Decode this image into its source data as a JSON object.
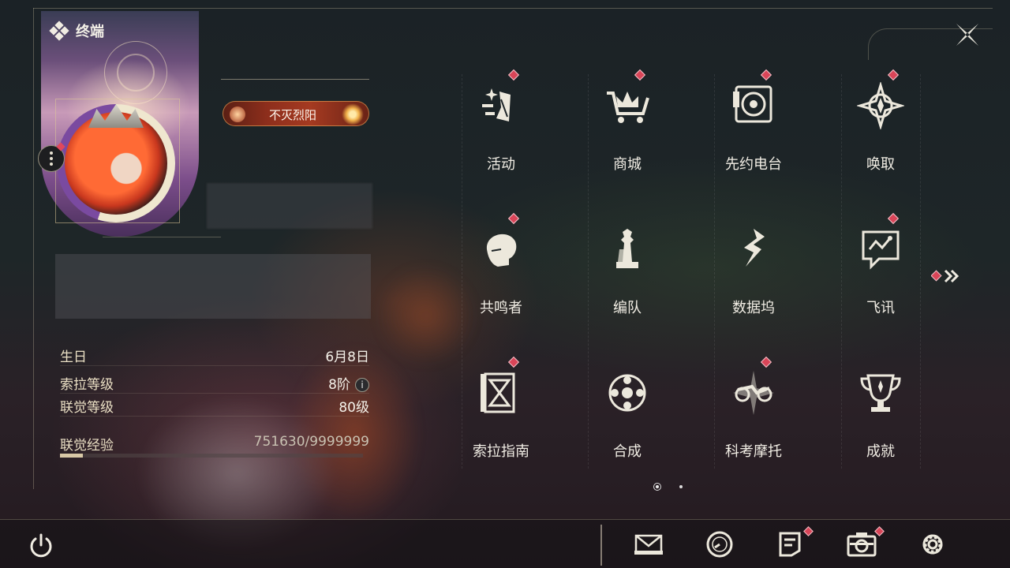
{
  "header": {
    "title": "终端",
    "logo_icon": "diamond-cluster-icon",
    "close_icon": "close-x-icon"
  },
  "profile": {
    "title_badge": "不灭烈阳",
    "more_icon": "more-dots-icon",
    "stats": [
      {
        "label": "生日",
        "value": "6月8日"
      },
      {
        "label": "索拉等级",
        "value": "8阶"
      },
      {
        "label": "联觉等级",
        "value": "80级"
      }
    ],
    "exp_label": "联觉经验",
    "exp_value": "751630/9999999",
    "exp_fraction": 0.075
  },
  "menu": {
    "items": [
      {
        "label": "活动",
        "icon": "activity-icon",
        "badge": true
      },
      {
        "label": "商城",
        "icon": "shop-cart-icon",
        "badge": true
      },
      {
        "label": "先约电台",
        "icon": "radio-icon",
        "badge": true
      },
      {
        "label": "唤取",
        "icon": "summon-star-icon",
        "badge": true
      },
      {
        "label": "共鸣者",
        "icon": "resonator-icon",
        "badge": true
      },
      {
        "label": "编队",
        "icon": "team-chess-icon",
        "badge": false
      },
      {
        "label": "数据坞",
        "icon": "data-dock-icon",
        "badge": false
      },
      {
        "label": "飞讯",
        "icon": "message-icon",
        "badge": true
      },
      {
        "label": "索拉指南",
        "icon": "guide-book-icon",
        "badge": true
      },
      {
        "label": "合成",
        "icon": "synthesis-icon",
        "badge": false
      },
      {
        "label": "科考摩托",
        "icon": "motorcycle-icon",
        "badge": true
      },
      {
        "label": "成就",
        "icon": "trophy-icon",
        "badge": false
      }
    ],
    "next_icon": "double-chevron-right-icon",
    "page": 1,
    "page_count": 2
  },
  "bottom_bar": {
    "power_icon": "power-icon",
    "icons": [
      {
        "icon": "mail-icon",
        "badge": false
      },
      {
        "icon": "clock-icon",
        "badge": false
      },
      {
        "icon": "notice-icon",
        "badge": true
      },
      {
        "icon": "camera-icon",
        "badge": true
      },
      {
        "icon": "settings-gear-icon",
        "badge": false
      }
    ]
  },
  "colors": {
    "accent_badge": "#d94558",
    "text_primary": "#f1ede4",
    "text_label": "#eadfc4"
  }
}
